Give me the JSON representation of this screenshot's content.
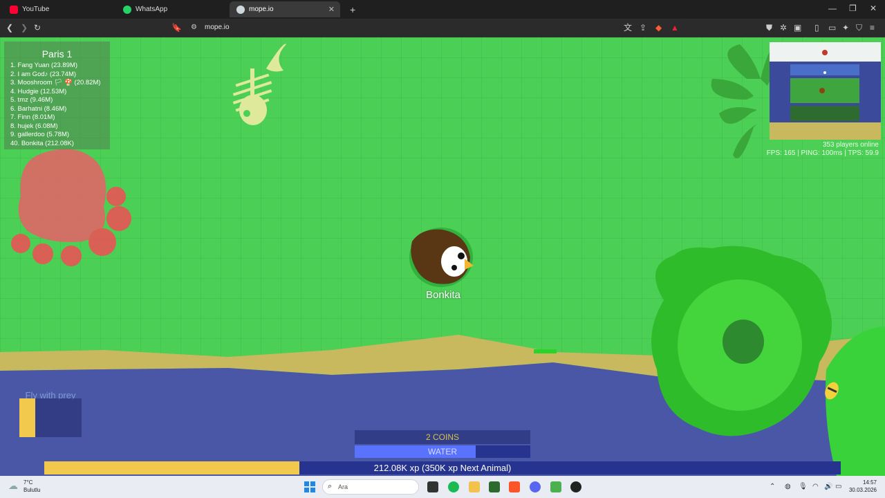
{
  "browser": {
    "tabs": [
      {
        "label": "YouTube",
        "icon": "youtube-icon"
      },
      {
        "label": "WhatsApp",
        "icon": "whatsapp-icon"
      },
      {
        "label": "mope.io",
        "icon": "mope-icon",
        "active": true
      }
    ],
    "new_tab": "+",
    "url": "mope.io"
  },
  "game": {
    "leaderboard": {
      "title": "Paris 1",
      "rows": [
        "1. Fang Yuan (23.89M)",
        "2. I am God♪ (23.74M)",
        "3. Mooshroom 🏳 🍄 (20.82M)",
        "4. Hudgie (12.53M)",
        "5. tmz (9.46M)",
        "6. Barhatni (8.46M)",
        "7. Finn (8.01M)",
        "8. hujek (6.08M)",
        "9.  gallerdoo (5.78M)",
        "40. Bonkita (212.08K)"
      ]
    },
    "stats": {
      "players_online": "353 players online",
      "perf": "FPS: 165 | PING: 100ms | TPS: 59.9"
    },
    "player_name": "Bonkita",
    "ability_label": "Fly with prey",
    "ability_level": 0.26,
    "coins": "2 COINS",
    "water": {
      "label": "WATER",
      "level": 0.69
    },
    "xp": {
      "label": "212.08K xp  (350K xp Next Animal)",
      "progress": 0.32
    }
  },
  "taskbar": {
    "weather_temp": "7°C",
    "weather_desc": "Bulutlu",
    "search_placeholder": "Ara",
    "time": "14:57",
    "date": "30.03.2026"
  },
  "colors": {
    "grass": "#4ccf55",
    "beach": "#c8b95e",
    "water": "#4a57a6",
    "xp_fill": "#f2c94c",
    "water_fill": "#5a73ff"
  }
}
